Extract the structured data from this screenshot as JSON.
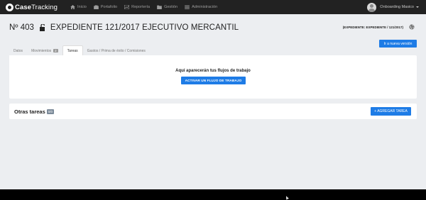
{
  "brand": {
    "name_bold": "Case",
    "name_regular": "Tracking"
  },
  "nav": [
    {
      "label": "Inicio",
      "icon": "home-icon"
    },
    {
      "label": "Portafolio",
      "icon": "briefcase-icon"
    },
    {
      "label": "Reportería",
      "icon": "chart-icon"
    },
    {
      "label": "Gestión",
      "icon": "folder-icon"
    },
    {
      "label": "Administración",
      "icon": "list-icon"
    }
  ],
  "user": {
    "name": "Onboarding Masico"
  },
  "page": {
    "number": "Nº 403",
    "title": "EXPEDIENTE 121/2017 EJECUTIVO MERCANTIL",
    "code": "(EXPEDIENTE: EXPEDIENTE / 121/2017)",
    "new_version_label": "Ir a nueva versión"
  },
  "tabs": [
    {
      "label": "Datos"
    },
    {
      "label": "Movimientos",
      "badge": "2"
    },
    {
      "label": "Tareas",
      "active": true
    },
    {
      "label": "Gastos / Prima de éxito / Comisiones"
    }
  ],
  "workflow": {
    "message": "Aquí aparecerán tus flujos de trabajo",
    "button_label": "ACTIVAR UN FLUJO DE TRABAJO"
  },
  "other_tasks": {
    "title": "Otras tareas",
    "badge": "0/0",
    "add_label": "+ AGREGAR TAREA"
  },
  "colors": {
    "accent": "#1e7ce6",
    "navbar": "#222222",
    "background": "#eceef1"
  }
}
